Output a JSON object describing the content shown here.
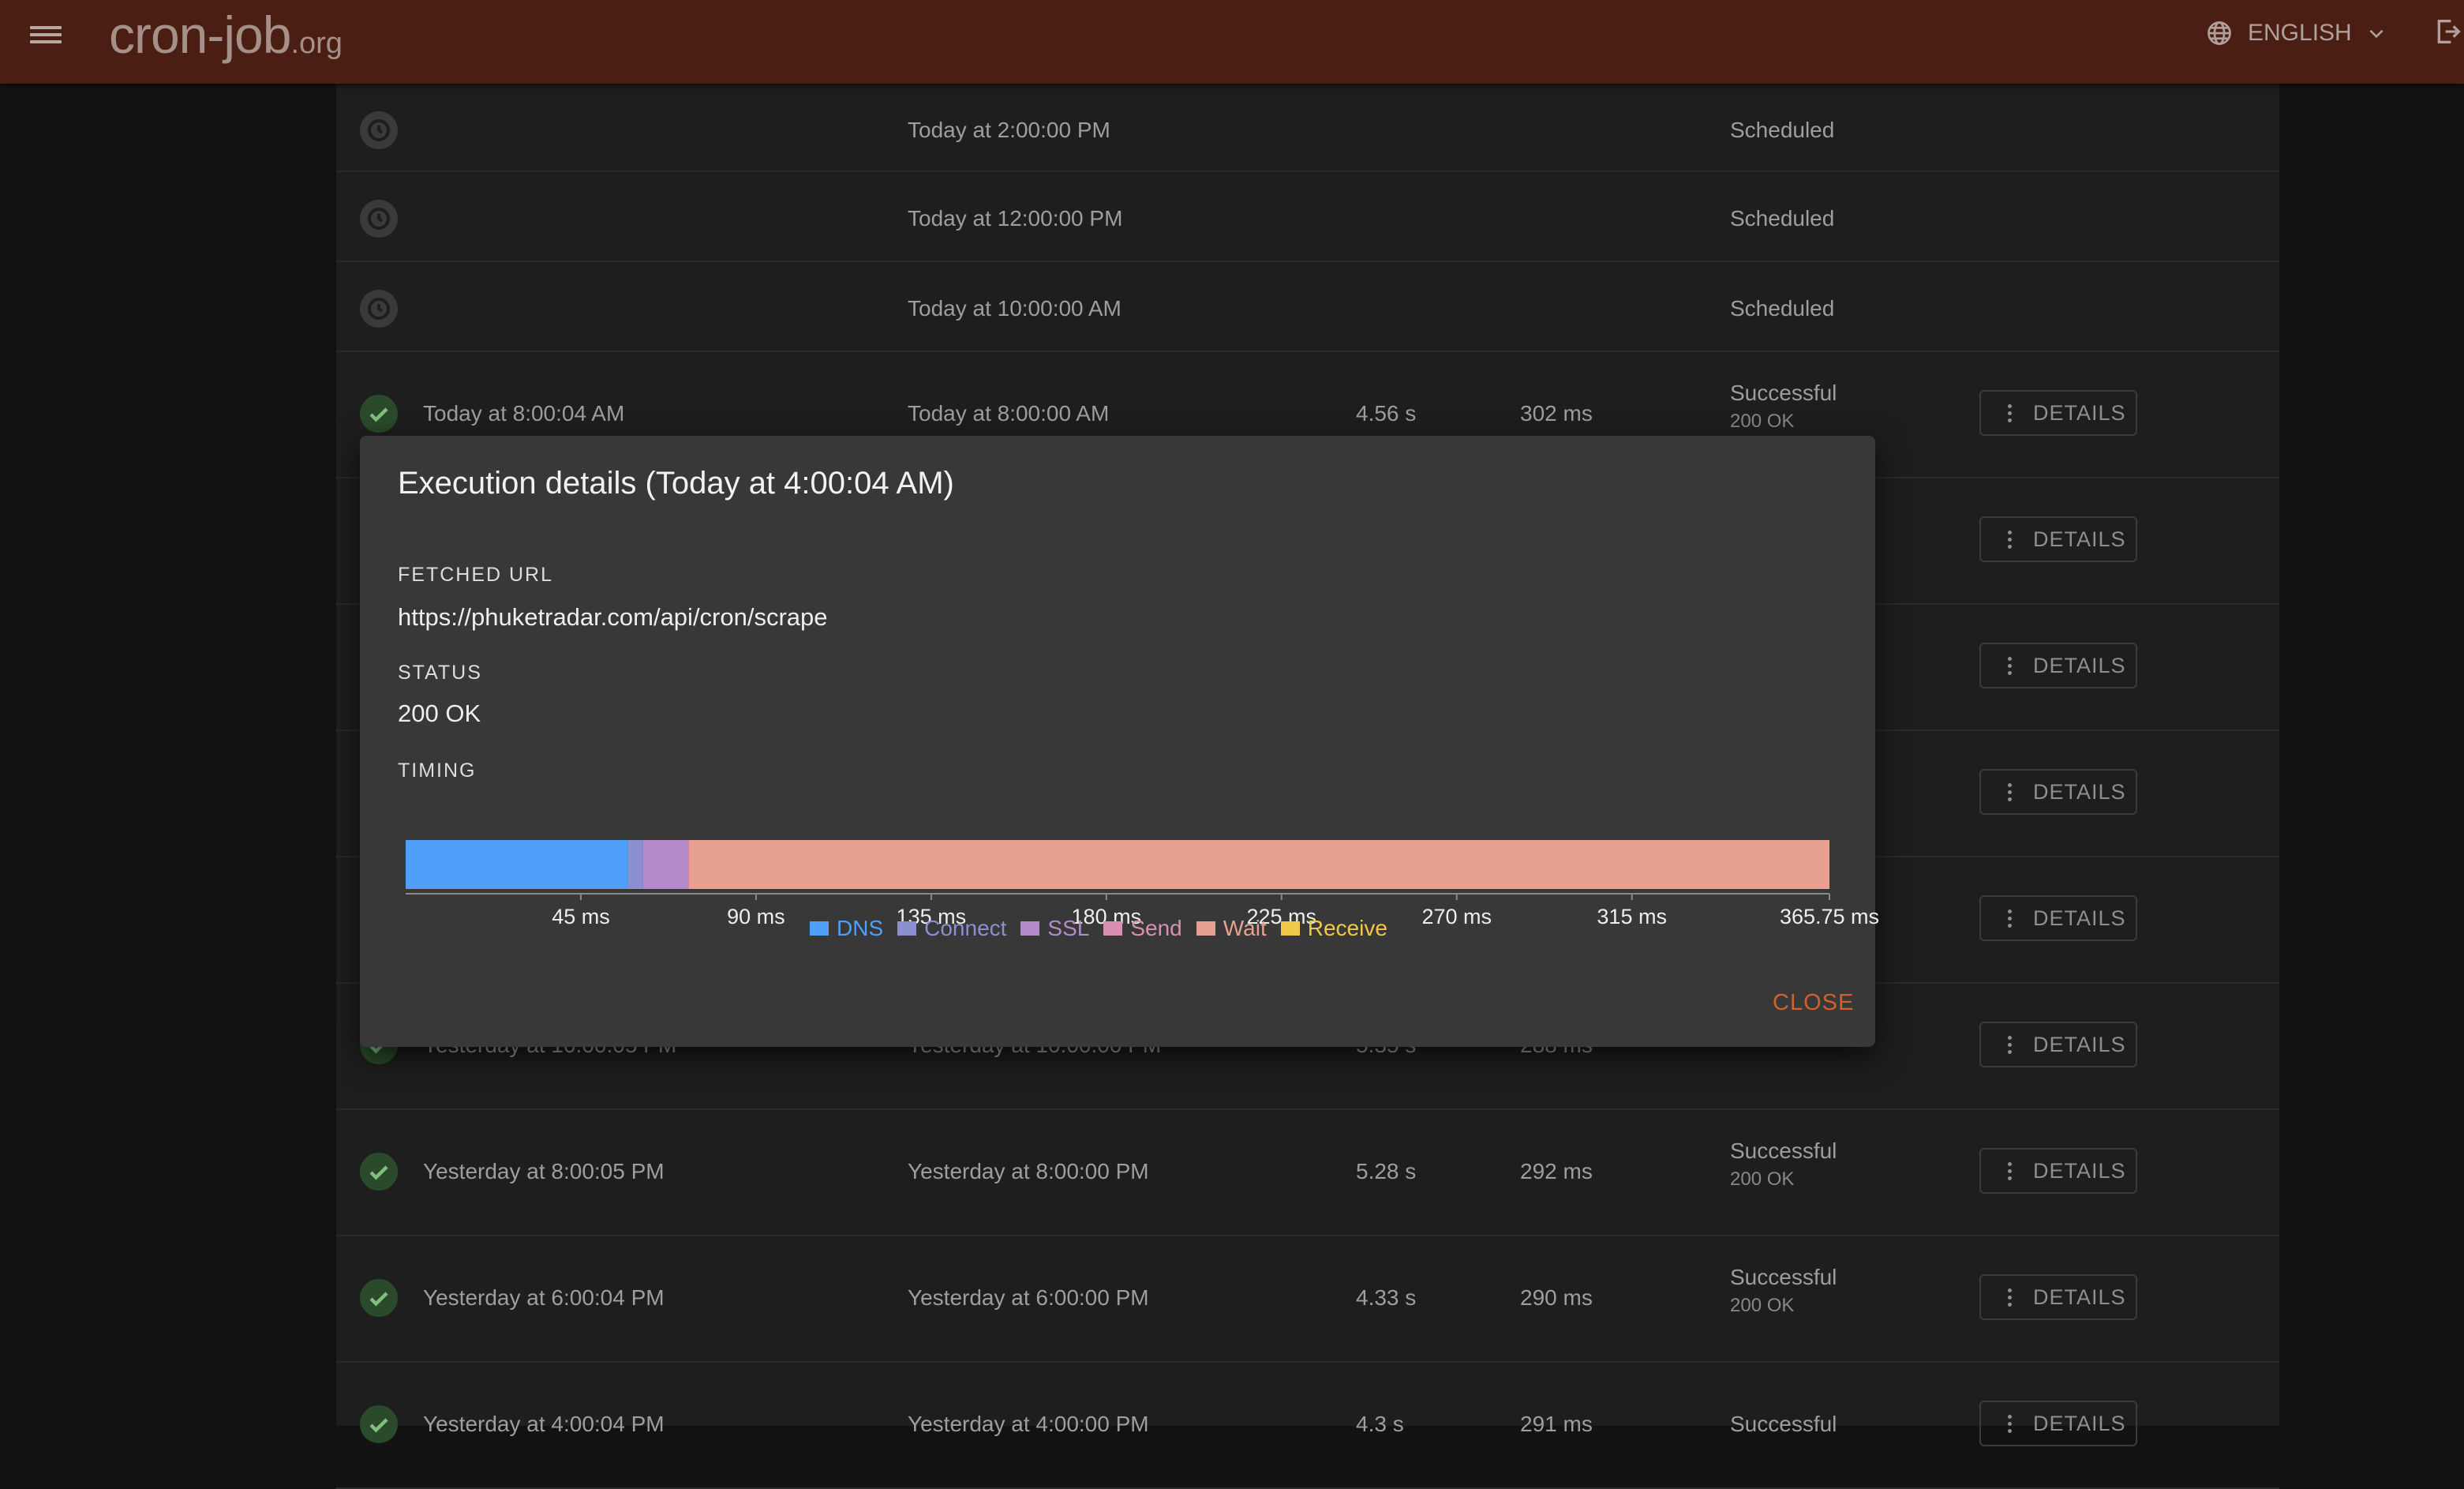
{
  "header": {
    "logo_main": "cron-job",
    "logo_tld": ".org",
    "language": "ENGLISH"
  },
  "rows": [
    {
      "status_icon": "clock-icon",
      "actual": "",
      "planned": "Today at 2:00:00 PM",
      "duration": "",
      "latency": "",
      "status": "Scheduled",
      "http": "",
      "has_details": false
    },
    {
      "status_icon": "clock-icon",
      "actual": "",
      "planned": "Today at 12:00:00 PM",
      "duration": "",
      "latency": "",
      "status": "Scheduled",
      "http": "",
      "has_details": false
    },
    {
      "status_icon": "clock-icon",
      "actual": "",
      "planned": "Today at 10:00:00 AM",
      "duration": "",
      "latency": "",
      "status": "Scheduled",
      "http": "",
      "has_details": false
    },
    {
      "status_icon": "check-icon",
      "actual": "Today at 8:00:04 AM",
      "planned": "Today at 8:00:00 AM",
      "duration": "4.56 s",
      "latency": "302 ms",
      "status": "Successful",
      "http": "200 OK",
      "has_details": true
    },
    {
      "status_icon": "check-icon",
      "has_details": true
    },
    {
      "status_icon": "check-icon",
      "has_details": true
    },
    {
      "status_icon": "check-icon",
      "has_details": true
    },
    {
      "status_icon": "check-icon",
      "has_details": true
    },
    {
      "status_icon": "check-icon",
      "actual": "Yesterday at 10:00:05 PM",
      "planned": "Yesterday at 10:00:00 PM",
      "duration": "5.35 s",
      "latency": "288 ms",
      "status": "",
      "http": "200 OK",
      "has_details": true
    },
    {
      "status_icon": "check-icon",
      "actual": "Yesterday at 8:00:05 PM",
      "planned": "Yesterday at 8:00:00 PM",
      "duration": "5.28 s",
      "latency": "292 ms",
      "status": "Successful",
      "http": "200 OK",
      "has_details": true
    },
    {
      "status_icon": "check-icon",
      "actual": "Yesterday at 6:00:04 PM",
      "planned": "Yesterday at 6:00:00 PM",
      "duration": "4.33 s",
      "latency": "290 ms",
      "status": "Successful",
      "http": "200 OK",
      "has_details": true
    },
    {
      "status_icon": "check-icon",
      "actual": "Yesterday at 4:00:04 PM",
      "planned": "Yesterday at 4:00:00 PM",
      "duration": "4.3 s",
      "latency": "291 ms",
      "status": "Successful",
      "http": "",
      "has_details": true
    }
  ],
  "details_label": "DETAILS",
  "dialog": {
    "title": "Execution details (Today at 4:00:04 AM)",
    "fetched_url_label": "FETCHED URL",
    "fetched_url": "https://phuketradar.com/api/cron/scrape",
    "status_label": "STATUS",
    "status_value": "200 OK",
    "timing_label": "TIMING",
    "close_label": "CLOSE"
  },
  "chart_data": {
    "type": "bar",
    "orientation": "horizontal-stacked",
    "axis_max_ms": 365.75,
    "ticks_ms": [
      45,
      90,
      135,
      180,
      225,
      270,
      315,
      365.75
    ],
    "tick_labels": [
      "45 ms",
      "90 ms",
      "135 ms",
      "180 ms",
      "225 ms",
      "270 ms",
      "315 ms",
      "365.75 ms"
    ],
    "series": [
      {
        "name": "DNS",
        "value_ms": 57,
        "color": "#4f9ef8"
      },
      {
        "name": "Connect",
        "value_ms": 4,
        "color": "#8a8fd0"
      },
      {
        "name": "SSL",
        "value_ms": 11.5,
        "color": "#b48ac8"
      },
      {
        "name": "Send",
        "value_ms": 0.25,
        "color": "#d98fb0"
      },
      {
        "name": "Wait",
        "value_ms": 293,
        "color": "#e8a090"
      },
      {
        "name": "Receive",
        "value_ms": 0,
        "color": "#f0c84a"
      }
    ]
  }
}
